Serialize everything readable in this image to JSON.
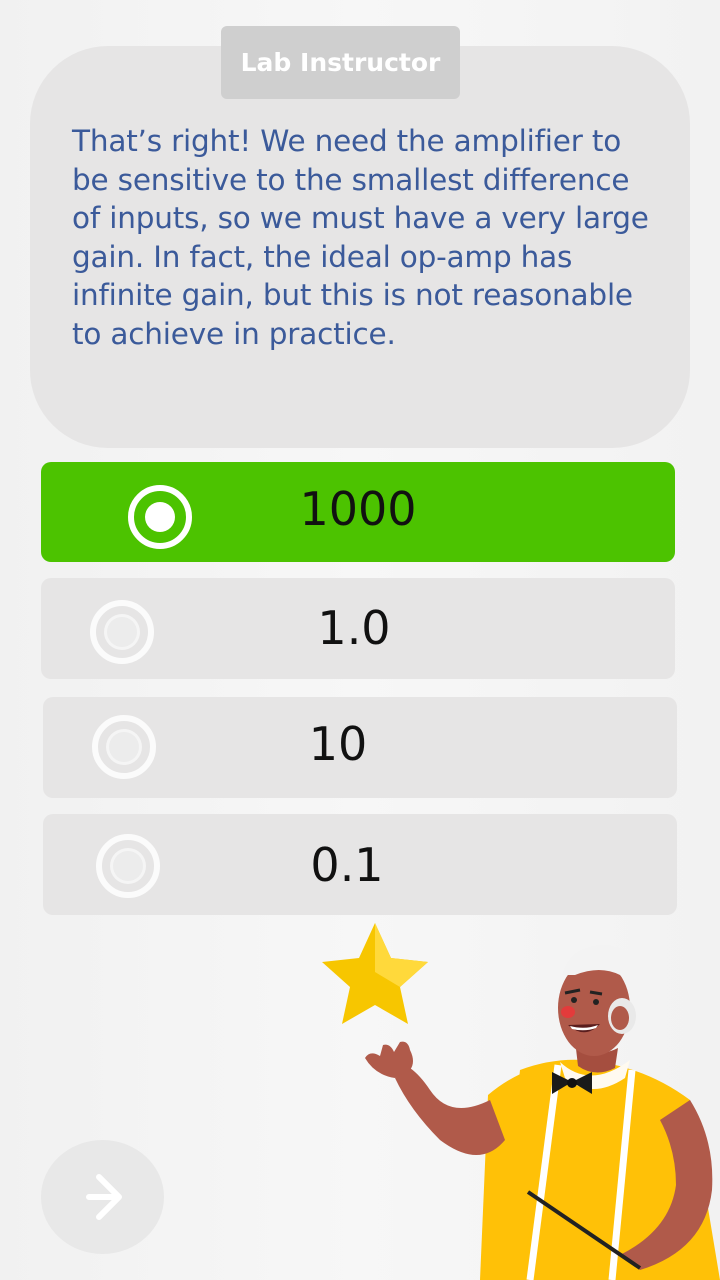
{
  "speaker": {
    "name": "Lab Instructor"
  },
  "feedback": {
    "message": "That’s right! We need the amplifier to be sensitive to the smallest difference of inputs, so we must have a very large gain. In fact, the ideal op-amp has infinite gain, but this is not reasonable to achieve in practice."
  },
  "options": [
    {
      "label": "1000",
      "selected": true
    },
    {
      "label": "1.0",
      "selected": false
    },
    {
      "label": "10",
      "selected": false
    },
    {
      "label": "0.1",
      "selected": false
    }
  ],
  "colors": {
    "correct": "#4cc300",
    "option_bg": "#e6e5e5",
    "message_text": "#3b5a9a",
    "bubble_bg": "#e6e5e5",
    "star": "#f7c600",
    "shirt": "#ffc107",
    "skin": "#b05a4a"
  },
  "icons": {
    "next": "arrow-right-icon",
    "reward": "star-icon",
    "radio": "radio-icon"
  },
  "illustration": "instructor-with-pointer"
}
